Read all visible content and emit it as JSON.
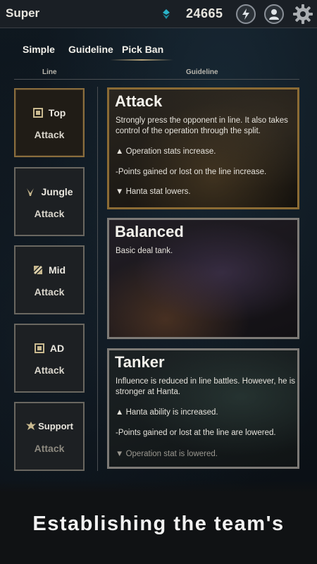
{
  "header": {
    "title": "Super",
    "points": "24665",
    "icons": [
      "diamond-icon",
      "lightning-icon",
      "profile-icon",
      "gear-icon"
    ]
  },
  "tabs": [
    {
      "label": "Simple"
    },
    {
      "label": "Guideline"
    },
    {
      "label": "Pick Ban"
    }
  ],
  "columns": {
    "line": "Line",
    "guideline": "Guideline"
  },
  "lanes": [
    {
      "name": "Top",
      "sub": "Attack",
      "icon": "top-lane-icon"
    },
    {
      "name": "Jungle",
      "sub": "Attack",
      "icon": "jungle-lane-icon"
    },
    {
      "name": "Mid",
      "sub": "Attack",
      "icon": "mid-lane-icon"
    },
    {
      "name": "AD",
      "sub": "Attack",
      "icon": "ad-lane-icon"
    },
    {
      "name": "Support",
      "sub": "Attack",
      "icon": "support-lane-icon"
    }
  ],
  "cards": [
    {
      "title": "Attack",
      "desc": "Strongly press the opponent in line. It also takes control of the operation through the split.",
      "lines": [
        "▲ Operation stats increase.",
        "-Points gained or lost on the line increase.",
        "▼ Hanta stat lowers."
      ]
    },
    {
      "title": "Balanced",
      "desc": "Basic deal tank.",
      "lines": []
    },
    {
      "title": "Tanker",
      "desc": "Influence is reduced in line battles. However, he is stronger at Hanta.",
      "lines": [
        "▲ Hanta ability is increased.",
        "-Points gained or lost at the line are lowered.",
        "▼ Operation stat is lowered."
      ]
    }
  ],
  "caption": "Establishing the team's",
  "colors": {
    "accent_gold": "#8b6b34",
    "border_gray": "#7d7a76",
    "topbar": "#1a1f25",
    "diamond": "#2ab3c8"
  }
}
